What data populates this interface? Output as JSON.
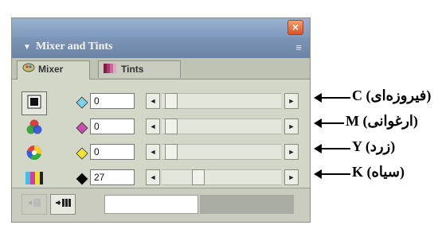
{
  "window": {
    "close_label": "×",
    "title": "Mixer and Tints",
    "menu_label": "≡",
    "header_arrow": "▼"
  },
  "tabs": [
    {
      "label": "Mixer",
      "active": true
    },
    {
      "label": "Tints",
      "active": false
    }
  ],
  "channels": [
    {
      "swatch_color": "#7fd0e8",
      "value": "0",
      "slider_value": 0,
      "annotation": "C (فیروزه‌ای)"
    },
    {
      "swatch_color": "#c64fb0",
      "value": "0",
      "slider_value": 0,
      "annotation": "M (ارغوانی)"
    },
    {
      "swatch_color": "#f3e33a",
      "value": "0",
      "slider_value": 0,
      "annotation": "Y (زرد)"
    },
    {
      "swatch_color": "#000000",
      "value": "27",
      "slider_value": 27,
      "annotation": "K (سیاه)"
    }
  ],
  "arrows": {
    "left": "◄",
    "right": "►"
  },
  "colors": {
    "accent_title": "#6b83a5",
    "close": "#d8542a",
    "panel": "#d3d7c8"
  },
  "icons": {
    "mode_1": "grayscale-mode-icon",
    "mode_2": "rgb-mode-icon",
    "mode_3": "hsb-mode-icon",
    "mode_4": "cmyk-mode-icon"
  }
}
